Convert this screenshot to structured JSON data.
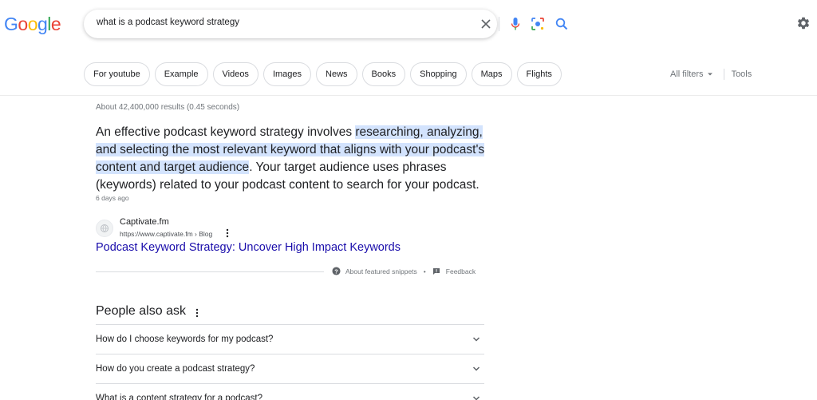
{
  "logo": {
    "letters": [
      "G",
      "o",
      "o",
      "g",
      "l",
      "e"
    ],
    "colors": [
      "#4285f4",
      "#ea4335",
      "#fbbc05",
      "#4285f4",
      "#34a853",
      "#ea4335"
    ]
  },
  "search": {
    "query": "what is a podcast keyword strategy"
  },
  "chips": [
    "For youtube",
    "Example",
    "Videos",
    "Images",
    "News",
    "Books",
    "Shopping",
    "Maps",
    "Flights"
  ],
  "tools": {
    "all_filters": "All filters",
    "tools": "Tools"
  },
  "stats": "About 42,400,000 results (0.45 seconds)",
  "snippet": {
    "before": "An effective podcast keyword strategy involves ",
    "highlight": "researching, analyzing, and selecting the most relevant keyword that aligns with your podcast's content and target audience",
    "after": ". Your target audience uses phrases (keywords) related to your podcast content to search for your podcast.",
    "date": "6 days ago"
  },
  "source": {
    "name": "Captivate.fm",
    "url": "https://www.captivate.fm › Blog",
    "title": "Podcast Keyword Strategy: Uncover High Impact Keywords"
  },
  "featured": {
    "about": "About featured snippets",
    "separator": "•",
    "feedback": "Feedback"
  },
  "paa": {
    "title": "People also ask",
    "questions": [
      "How do I choose keywords for my podcast?",
      "How do you create a podcast strategy?",
      "What is a content strategy for a podcast?"
    ]
  },
  "colors": {
    "link": "#1a0dab",
    "highlight": "#d3e3fd",
    "muted": "#70757a",
    "border": "#dadce0"
  },
  "icons": [
    "clear-icon",
    "mic-icon",
    "lens-icon",
    "search-icon",
    "gear-icon",
    "caret-down-icon",
    "more-vert-icon",
    "help-icon",
    "feedback-icon",
    "chevron-down-icon",
    "globe-icon"
  ]
}
